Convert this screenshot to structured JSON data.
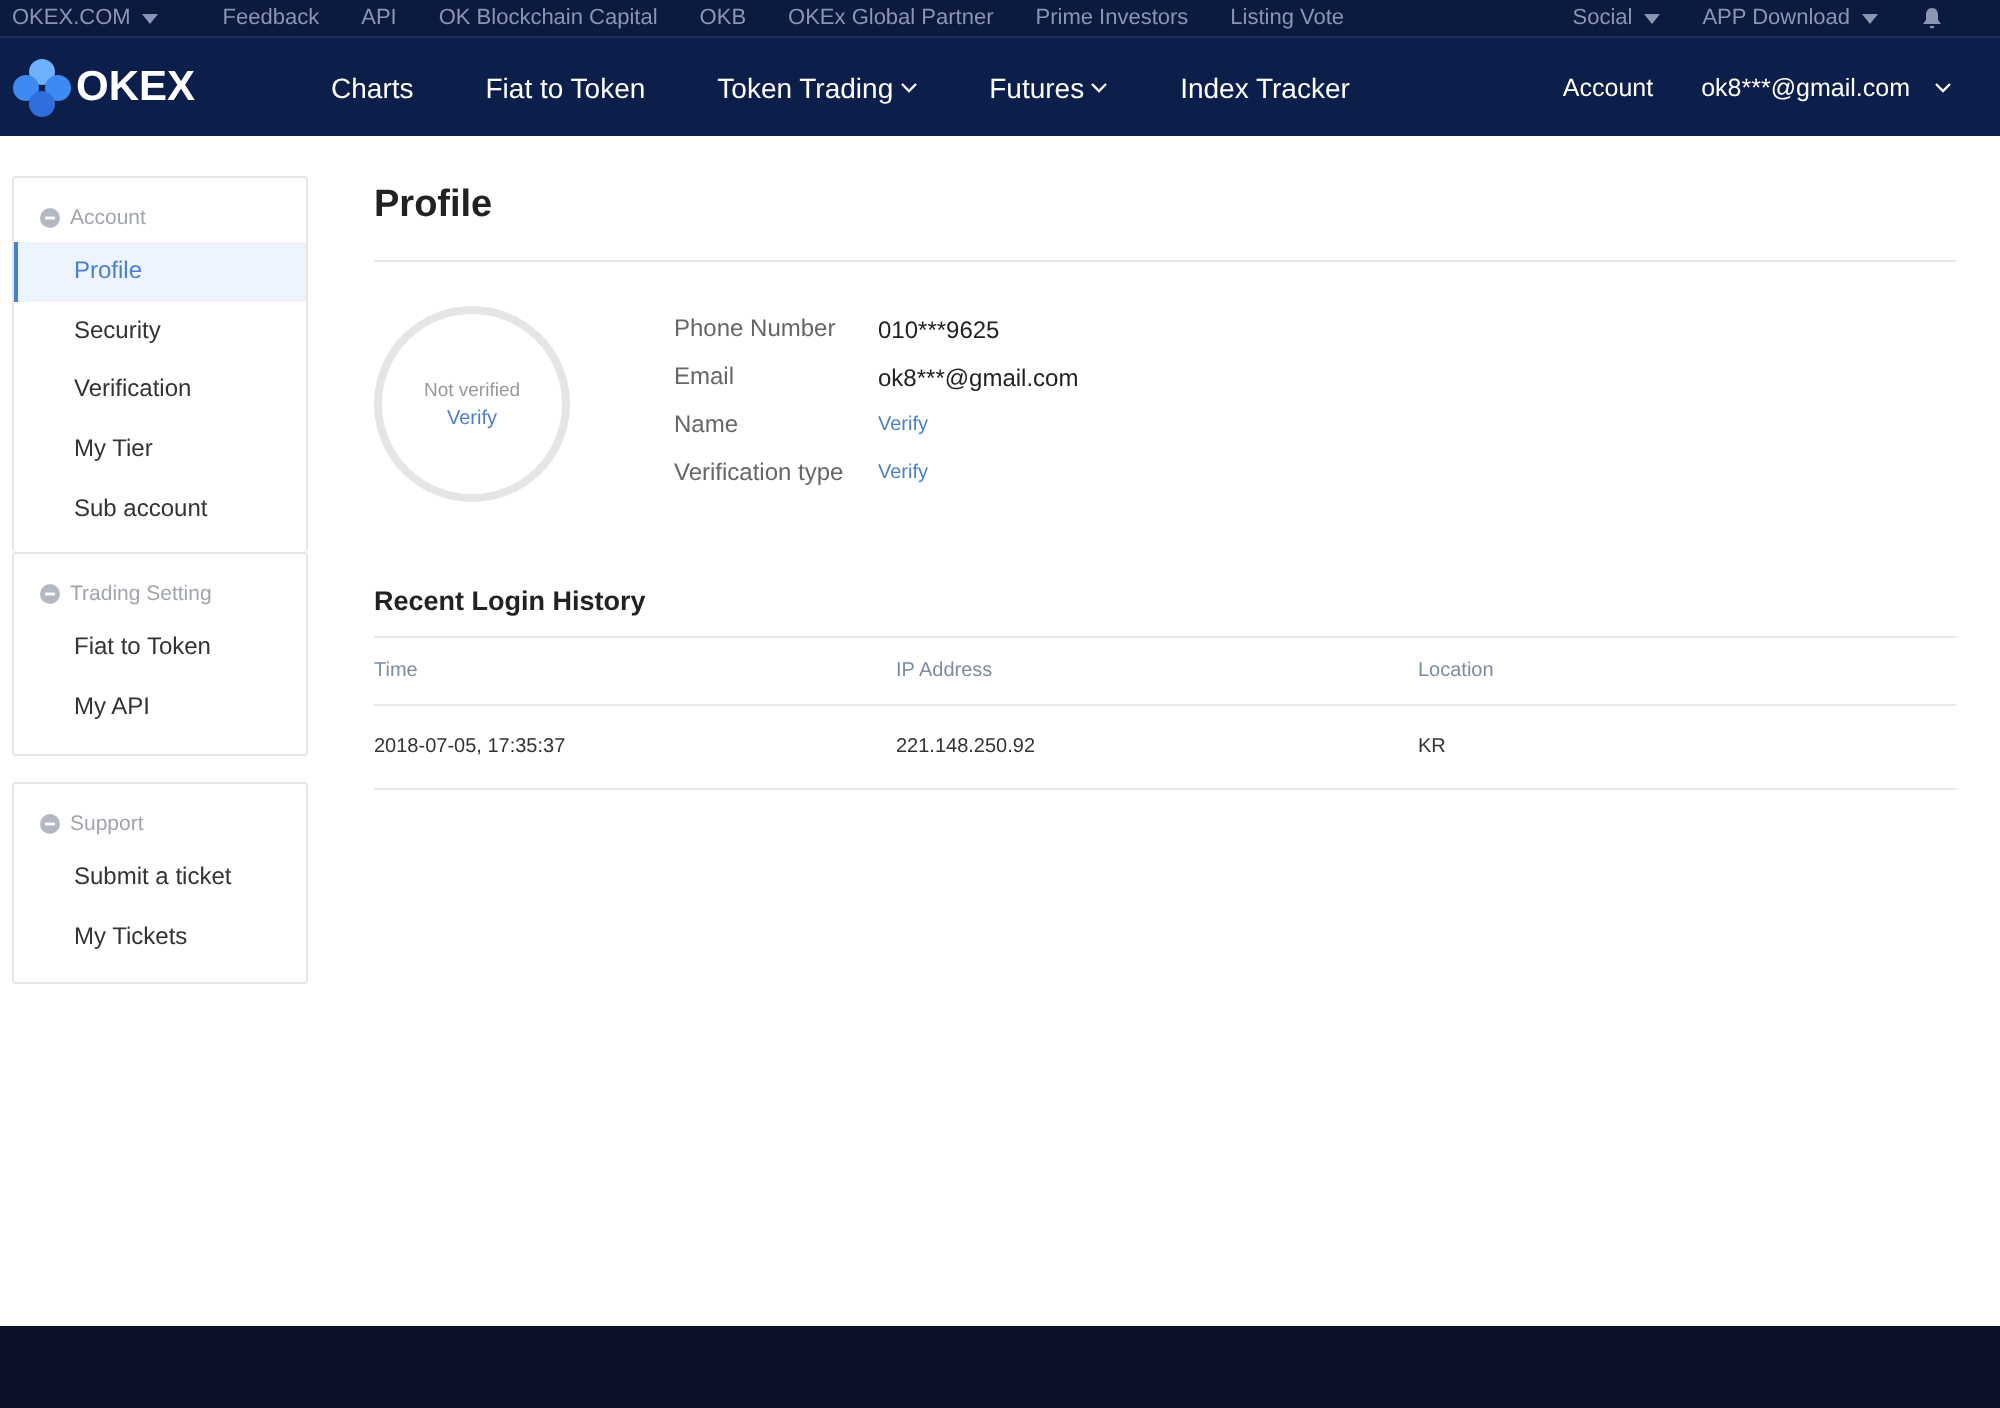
{
  "top_bar": {
    "site": "OKEX.COM",
    "links": [
      "Feedback",
      "API",
      "OK Blockchain Capital",
      "OKB",
      "OKEx Global Partner",
      "Prime Investors",
      "Listing Vote"
    ],
    "right": [
      "Social",
      "APP Download"
    ]
  },
  "nav": {
    "logo": "OKEX",
    "items": [
      {
        "label": "Charts",
        "dropdown": false
      },
      {
        "label": "Fiat to Token",
        "dropdown": false
      },
      {
        "label": "Token Trading",
        "dropdown": true
      },
      {
        "label": "Futures",
        "dropdown": true
      },
      {
        "label": "Index Tracker",
        "dropdown": false
      }
    ],
    "account": "Account",
    "user": "ok8***@gmail.com"
  },
  "sidebar": [
    {
      "title": "Account",
      "items": [
        {
          "label": "Profile",
          "selected": true
        },
        {
          "label": "Security",
          "selected": false
        },
        {
          "label": "Verification",
          "selected": false
        },
        {
          "label": "My Tier",
          "selected": false
        },
        {
          "label": "Sub account",
          "selected": false
        }
      ]
    },
    {
      "title": "Trading Setting",
      "items": [
        {
          "label": "Fiat to Token",
          "selected": false
        },
        {
          "label": "My API",
          "selected": false
        }
      ]
    },
    {
      "title": "Support",
      "items": [
        {
          "label": "Submit a ticket",
          "selected": false
        },
        {
          "label": "My Tickets",
          "selected": false
        }
      ]
    }
  ],
  "profile": {
    "title": "Profile",
    "status": "Not verified",
    "status_link": "Verify",
    "fields": [
      {
        "label": "Phone Number",
        "value": "010***9625",
        "kind": "text"
      },
      {
        "label": "Email",
        "value": "ok8***@gmail.com",
        "kind": "text"
      },
      {
        "label": "Name",
        "value": "Verify",
        "kind": "link"
      },
      {
        "label": "Verification type",
        "value": "Verify",
        "kind": "link"
      }
    ]
  },
  "login_history": {
    "title": "Recent Login History",
    "columns": [
      "Time",
      "IP Address",
      "Location"
    ],
    "rows": [
      [
        "2018-07-05, 17:35:37",
        "221.148.250.92",
        "KR"
      ]
    ]
  }
}
